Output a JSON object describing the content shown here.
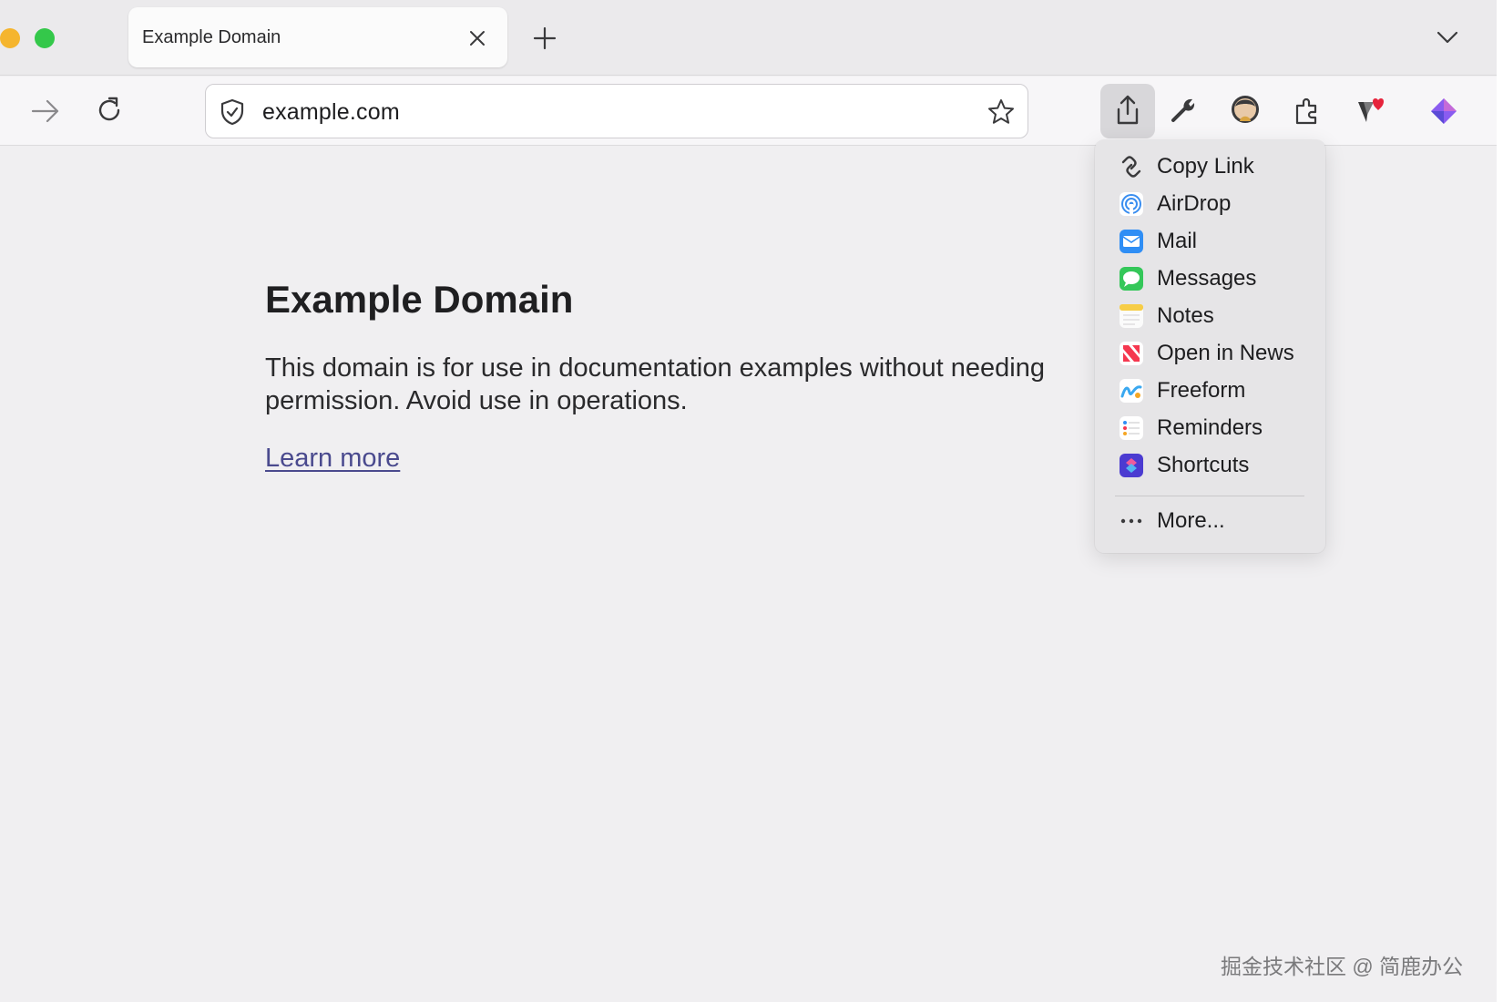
{
  "tabs": [
    {
      "title": "Example Domain"
    }
  ],
  "toolbar": {
    "address": "example.com"
  },
  "page": {
    "heading": "Example Domain",
    "paragraph": "This domain is for use in documentation examples without needing permission. Avoid use in operations.",
    "link": "Learn more"
  },
  "share_menu": {
    "items": [
      {
        "label": "Copy Link",
        "icon": "link-icon"
      },
      {
        "label": "AirDrop",
        "icon": "airdrop-icon"
      },
      {
        "label": "Mail",
        "icon": "mail-icon"
      },
      {
        "label": "Messages",
        "icon": "messages-icon"
      },
      {
        "label": "Notes",
        "icon": "notes-icon"
      },
      {
        "label": "Open in News",
        "icon": "news-icon"
      },
      {
        "label": "Freeform",
        "icon": "freeform-icon"
      },
      {
        "label": "Reminders",
        "icon": "reminders-icon"
      },
      {
        "label": "Shortcuts",
        "icon": "shortcuts-icon"
      }
    ],
    "more": "More..."
  },
  "watermark": "掘金技术社区 @ 简鹿办公",
  "colors": {
    "accent_link": "#4a4a8e",
    "traffic_yellow": "#f5b52e",
    "traffic_green": "#34c84a"
  }
}
